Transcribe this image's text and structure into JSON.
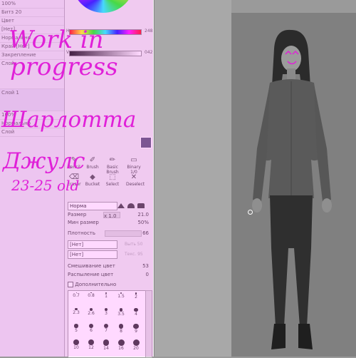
{
  "left_panel": {
    "rows": [
      "100%",
      "Битз 20",
      "Цвет",
      "[Нет]",
      "Нормально",
      "Край [Нет]",
      "Закрепление",
      "Слой",
      "",
      "Слой 1",
      "",
      "100%",
      "Нормально",
      "Слой"
    ]
  },
  "color": {
    "top_value": "248",
    "bottom_value": "042"
  },
  "tools": [
    {
      "label": "Pencil",
      "icon": "✎"
    },
    {
      "label": "Brush",
      "icon": "✐"
    },
    {
      "label": "Basic Brush",
      "icon": "✏"
    },
    {
      "label": "Binary 1/0",
      "icon": "▭"
    },
    {
      "label": "Eraser",
      "icon": "⌫"
    },
    {
      "label": "Bucket",
      "icon": "◆"
    },
    {
      "label": "Select",
      "icon": "⬚"
    },
    {
      "label": "Deselect",
      "icon": "✕"
    }
  ],
  "brush_mode": "Норма",
  "properties": {
    "size_label": "Размер",
    "size_multiplier": "x 1.0",
    "size_value": "21.0",
    "min_size_label": "Мин размер",
    "min_size_value": "50%",
    "density_label": "Плотность",
    "density_value": "66",
    "select1": "[Нет]",
    "select1_side": "Выть 50",
    "select2": "[Нет]",
    "select2_side": "Текс. 95",
    "color_mix_label": "Смешивание цвет",
    "color_mix_value": "53",
    "color_spray_label": "Распыление цвет",
    "color_spray_value": "0",
    "advanced_label": "Дополнительно"
  },
  "brush_sizes": [
    "0.7",
    "0.8",
    "1",
    "1.5",
    "2",
    "2.3",
    "2.6",
    "3",
    "3.5",
    "4",
    "5",
    "6",
    "7",
    "8",
    "9",
    "10",
    "12",
    "14",
    "16",
    "20"
  ],
  "handwriting": {
    "line1": "Work in",
    "line2": "progress",
    "line3": "Шарлотта",
    "line4": "Джулс",
    "line5": "23-25 old"
  },
  "colors": {
    "overlay": "#e020d8",
    "canvas": "#808080"
  }
}
